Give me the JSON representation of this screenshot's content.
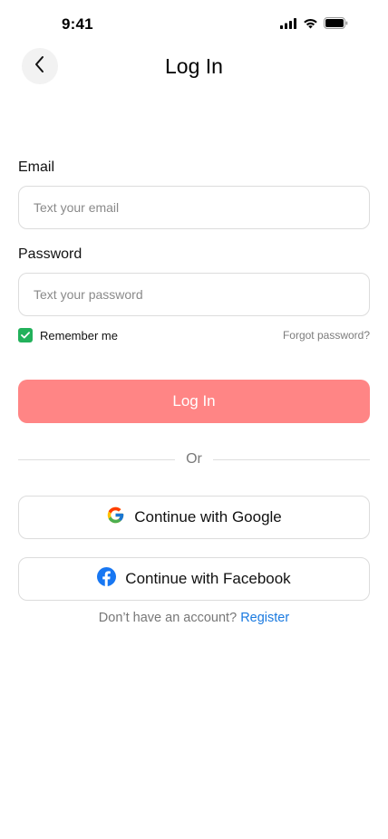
{
  "status_bar": {
    "time": "9:41",
    "icons": [
      "signal-icon",
      "wifi-icon",
      "battery-icon"
    ]
  },
  "header": {
    "back_icon": "chevron-left-icon",
    "title": "Log In"
  },
  "form": {
    "email": {
      "label": "Email",
      "placeholder": "Text your email",
      "value": ""
    },
    "password": {
      "label": "Password",
      "placeholder": "Text your password",
      "value": ""
    },
    "remember": {
      "label": "Remember me",
      "checked": true
    },
    "forgot_label": "Forgot password?",
    "submit_label": "Log In"
  },
  "divider": {
    "label": "Or"
  },
  "social": {
    "google_label": "Continue with Google",
    "facebook_label": "Continue with Facebook"
  },
  "footer": {
    "prompt": "Don’t have an account?",
    "register_label": "Register"
  },
  "colors": {
    "primary_button": "#ff8585",
    "checkbox": "#22b15b",
    "link": "#1a7ae0",
    "facebook": "#1877f2"
  }
}
